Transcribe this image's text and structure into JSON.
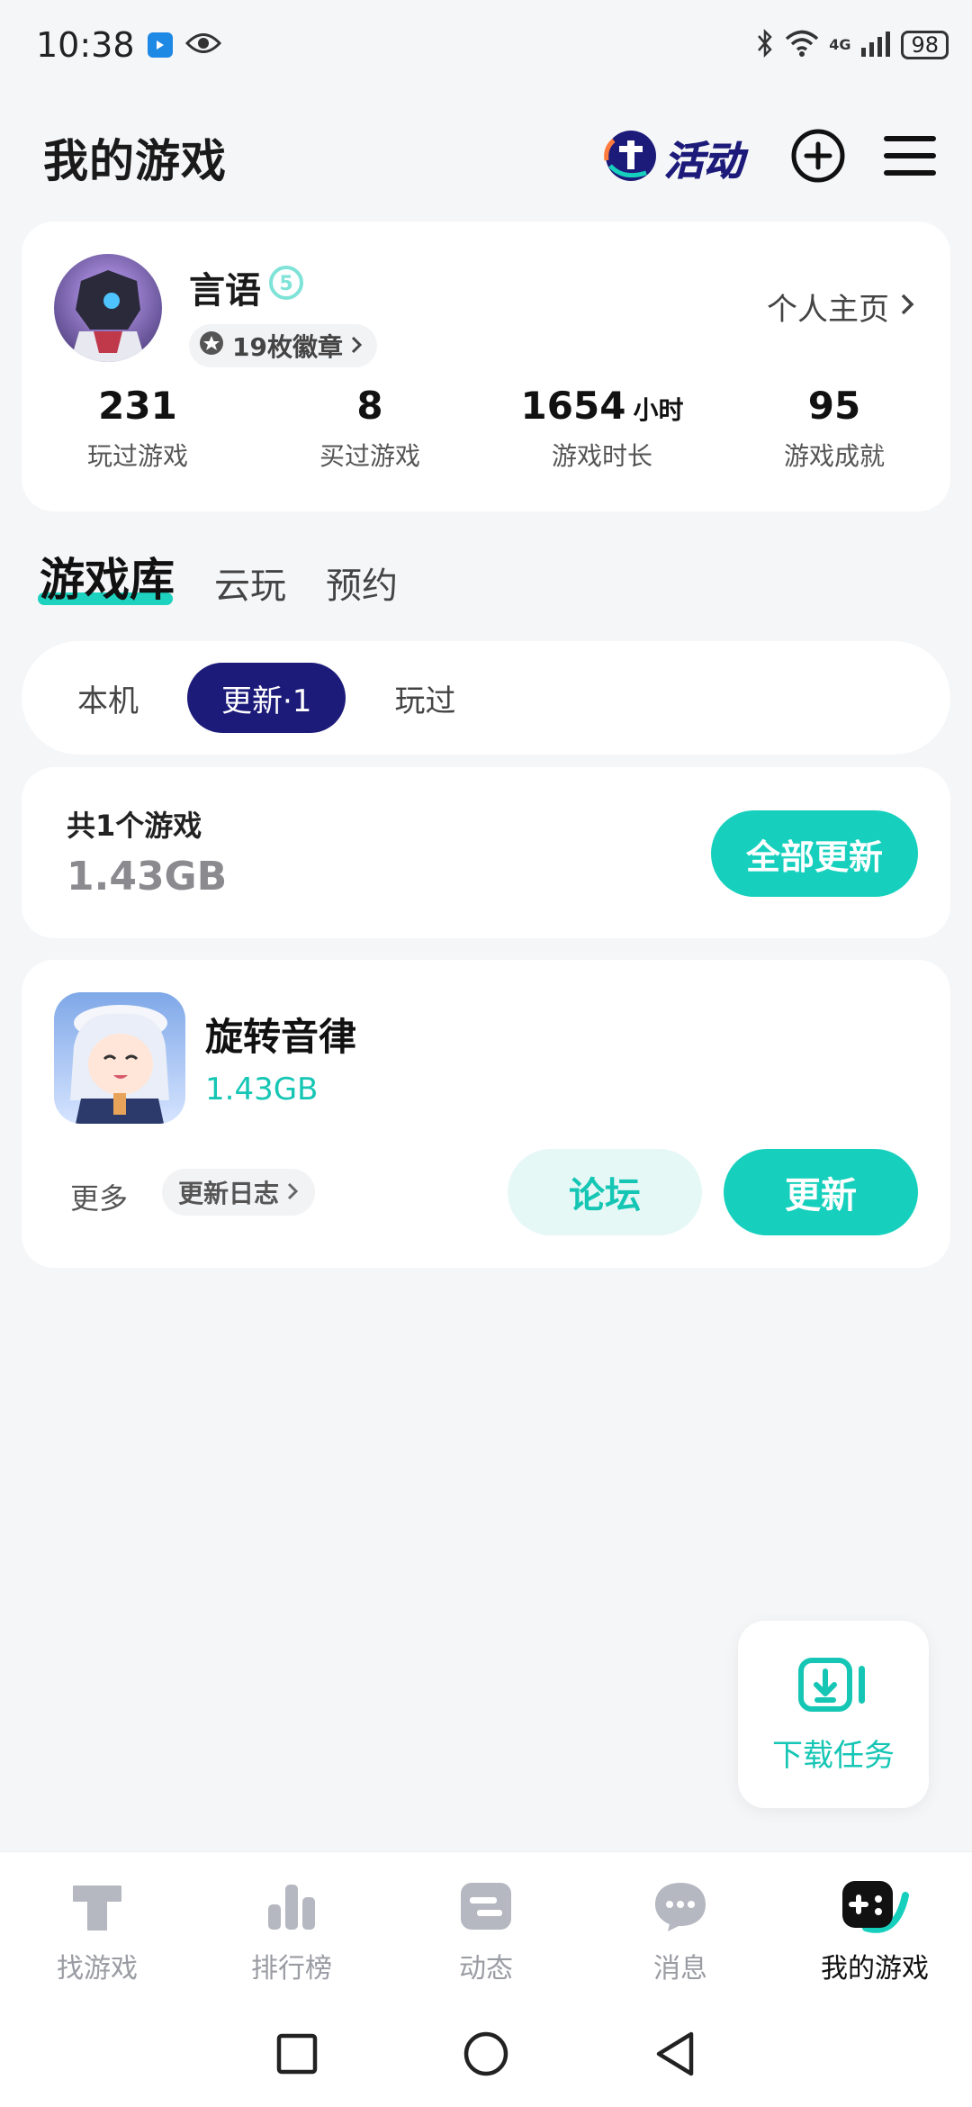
{
  "status_bar": {
    "time": "10:38",
    "network": "4G",
    "battery": "98"
  },
  "header": {
    "title": "我的游戏",
    "activity_label": "活动"
  },
  "profile": {
    "username": "言语",
    "level_badge": "5",
    "badges_label": "19枚徽章",
    "homepage_label": "个人主页",
    "stats": [
      {
        "value": "231",
        "unit": "",
        "label": "玩过游戏"
      },
      {
        "value": "8",
        "unit": "",
        "label": "买过游戏"
      },
      {
        "value": "1654",
        "unit": "小时",
        "label": "游戏时长"
      },
      {
        "value": "95",
        "unit": "",
        "label": "游戏成就"
      }
    ]
  },
  "tabs": [
    {
      "label": "游戏库",
      "active": true
    },
    {
      "label": "云玩",
      "active": false
    },
    {
      "label": "预约",
      "active": false
    }
  ],
  "filters": [
    {
      "label": "本机",
      "active": false
    },
    {
      "label": "更新·1",
      "active": true
    },
    {
      "label": "玩过",
      "active": false
    }
  ],
  "summary": {
    "count_label": "共1个游戏",
    "total_size": "1.43GB",
    "update_all_label": "全部更新"
  },
  "game": {
    "name": "旋转音律",
    "size": "1.43GB",
    "more_label": "更多",
    "changelog_label": "更新日志",
    "forum_label": "论坛",
    "update_label": "更新"
  },
  "download_fab": {
    "label": "下载任务"
  },
  "bottom_nav": [
    {
      "label": "找游戏",
      "icon": "find-games-icon",
      "active": false
    },
    {
      "label": "排行榜",
      "icon": "ranking-icon",
      "active": false
    },
    {
      "label": "动态",
      "icon": "feed-icon",
      "active": false
    },
    {
      "label": "消息",
      "icon": "messages-icon",
      "active": false
    },
    {
      "label": "我的游戏",
      "icon": "my-games-icon",
      "active": true
    }
  ],
  "colors": {
    "accent": "#16d0bd",
    "primary_dark": "#1d1b7a",
    "background": "#f5f6f8"
  }
}
